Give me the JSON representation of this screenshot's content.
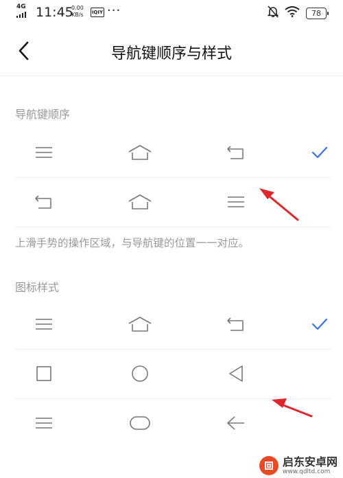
{
  "status_bar": {
    "network": "4G",
    "time": "11:45",
    "speed_value": "0.00",
    "speed_unit": "KB/s",
    "app_badge": "iQIY",
    "more": "···",
    "battery": "78"
  },
  "header": {
    "title": "导航键顺序与样式",
    "back_icon": "chevron-left-icon"
  },
  "order_section": {
    "title": "导航键顺序",
    "options": [
      {
        "icons": [
          "menu-icon",
          "home-icon",
          "back-icon"
        ],
        "selected": true
      },
      {
        "icons": [
          "back-icon",
          "home-icon",
          "menu-icon"
        ],
        "selected": false
      }
    ]
  },
  "hint": "上滑手势的操作区域，与导航键的位置一一对应。",
  "style_section": {
    "title": "图标样式",
    "options": [
      {
        "icons": [
          "menu-icon",
          "home-icon",
          "back-icon"
        ],
        "selected": true
      },
      {
        "icons": [
          "square-icon",
          "circle-icon",
          "triangle-icon"
        ],
        "selected": false
      },
      {
        "icons": [
          "menu-icon",
          "pill-icon",
          "arrow-left-icon"
        ],
        "selected": false
      }
    ]
  },
  "colors": {
    "accent": "#3a6ee8",
    "icon": "#777777",
    "annotation": "#e0262b"
  },
  "watermark": {
    "name": "启东安卓网",
    "url": "www.qdltd.com"
  }
}
